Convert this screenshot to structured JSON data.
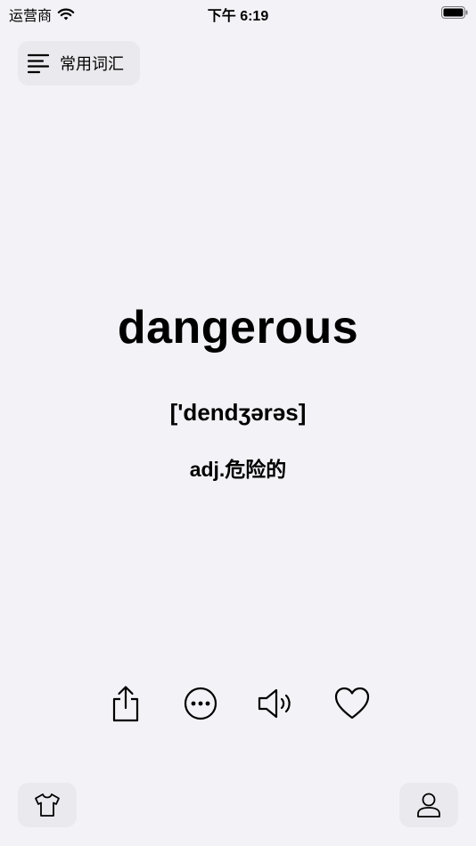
{
  "status_bar": {
    "carrier": "运营商",
    "time": "下午 6:19"
  },
  "header": {
    "category_label": "常用词汇",
    "menu_icon": "menu-lines-icon"
  },
  "card": {
    "word": "dangerous",
    "phonetic": "['dendʒərəs]",
    "meaning": "adj.危险的"
  },
  "actions": [
    {
      "icon": "share-icon"
    },
    {
      "icon": "more-icon"
    },
    {
      "icon": "speaker-icon"
    },
    {
      "icon": "heart-icon"
    }
  ],
  "bottom_bar": {
    "left_icon": "tshirt-icon",
    "right_icon": "profile-icon"
  }
}
